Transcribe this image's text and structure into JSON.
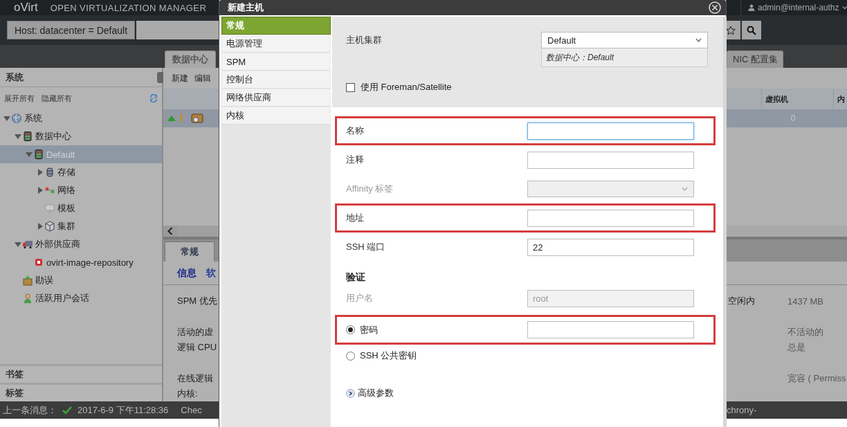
{
  "header": {
    "logo": "oVirt",
    "product": "OPEN VIRTUALIZATION MANAGER",
    "user": "admin@internal-authz"
  },
  "search": {
    "query": "Host: datacenter = Default"
  },
  "main_tabs": [
    {
      "label": "数据中心",
      "selected": true
    },
    {
      "label": "NIC 配置集",
      "selected": false
    }
  ],
  "tree_panel": {
    "title": "系统",
    "actions": [
      "展开所有",
      "隐藏所有"
    ],
    "tree": [
      {
        "label": "系统",
        "kind": "globe",
        "expanded": true,
        "selected": false,
        "children": [
          {
            "label": "数据中心",
            "kind": "datacenter",
            "expanded": true,
            "selected": false,
            "children": [
              {
                "label": "Default",
                "kind": "datacenter",
                "expanded": true,
                "selected": true,
                "children": [
                  {
                    "label": "存储",
                    "kind": "storage",
                    "expanded": false,
                    "selected": false
                  },
                  {
                    "label": "网络",
                    "kind": "network",
                    "expanded": false,
                    "selected": false
                  },
                  {
                    "label": "模板",
                    "kind": "template",
                    "selected": false
                  },
                  {
                    "label": "集群",
                    "kind": "cluster",
                    "expanded": false,
                    "selected": false
                  }
                ]
              }
            ]
          },
          {
            "label": "外部供应商",
            "kind": "truck",
            "expanded": true,
            "selected": false,
            "children": [
              {
                "label": "ovirt-image-repository",
                "kind": "repository",
                "selected": false
              }
            ]
          },
          {
            "label": "勘误",
            "kind": "package",
            "selected": false
          },
          {
            "label": "活跃用户会话",
            "kind": "user",
            "selected": false
          }
        ]
      }
    ]
  },
  "bookmarks": {
    "title": "书签"
  },
  "tags": {
    "title": "标签"
  },
  "grid": {
    "actions": [
      "新建",
      "编辑"
    ],
    "columns": [
      "虚拟机",
      "内"
    ],
    "rows": [
      {
        "selected": true,
        "cells": [
          "0"
        ]
      }
    ]
  },
  "detail_tabs": [
    {
      "label": "常规",
      "selected": true
    }
  ],
  "detail_subtabs": [
    {
      "label": "信息",
      "selected": true
    },
    {
      "label": "软",
      "selected": false
    }
  ],
  "details": [
    [
      {
        "label": "SPM 优先",
        "right_label": "空闲内",
        "right_value": "1437 MB"
      }
    ],
    [
      {
        "label": "活动的虚",
        "right_value": "不活动的"
      },
      {
        "label": "逻辑 CPU",
        "right_value": "总是"
      }
    ],
    [
      {
        "label": "在线逻辑",
        "right_value": "宽容 ( Permiss"
      },
      {
        "label": "内核:"
      }
    ]
  ],
  "status_bar": {
    "label": "上一条消息：",
    "time": "2017-6-9 下午11:28:36",
    "message": "Chec",
    "message_2": "chrony-"
  },
  "dialog": {
    "title": "新建主机",
    "nav": [
      {
        "label": "常规",
        "selected": true
      },
      {
        "label": "电源管理",
        "selected": false
      },
      {
        "label": "SPM",
        "selected": false
      },
      {
        "label": "控制台",
        "selected": false
      },
      {
        "label": "网络供应商",
        "selected": false
      },
      {
        "label": "内核",
        "selected": false
      }
    ],
    "cluster": {
      "label": "主机集群",
      "value": "Default",
      "note": "数据中心：Default"
    },
    "foreman": {
      "label": "使用 Foreman/Satellite",
      "checked": false
    },
    "fields": [
      {
        "kind": "input",
        "label": "名称",
        "highlighted": true,
        "focused": true,
        "disabled": false
      },
      {
        "kind": "input",
        "label": "注释",
        "highlighted": false,
        "focused": false,
        "disabled": false
      },
      {
        "kind": "select",
        "label": "Affinity 标签",
        "highlighted": false,
        "disabled": true
      },
      {
        "kind": "input",
        "label": "地址",
        "highlighted": true,
        "focused": false,
        "disabled": false
      },
      {
        "kind": "input",
        "label": "SSH 端口",
        "value": "22",
        "highlighted": false,
        "focused": false,
        "disabled": false
      },
      {
        "kind": "heading",
        "label": "验证"
      },
      {
        "kind": "input",
        "label": "用户名",
        "value": "root",
        "highlighted": false,
        "focused": false,
        "disabled": true
      },
      {
        "kind": "radio_input",
        "label": "密码",
        "selected": true,
        "highlighted": true
      },
      {
        "kind": "radio",
        "label": "SSH 公共密钥",
        "selected": false,
        "highlighted": false
      },
      {
        "kind": "expander",
        "label": "高级参数",
        "expanded": false
      }
    ]
  }
}
